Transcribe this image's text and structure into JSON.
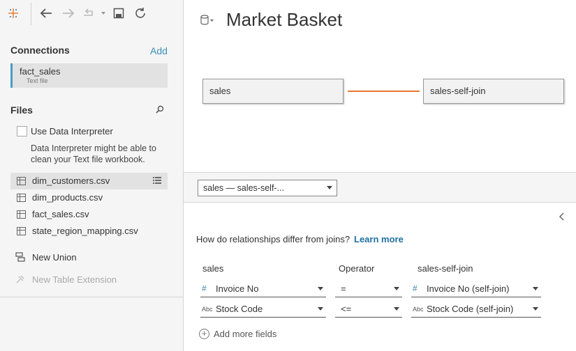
{
  "toolbar": {
    "icons": [
      "tableau-logo-icon",
      "back-icon",
      "forward-icon",
      "redo-icon",
      "save-icon",
      "refresh-icon"
    ]
  },
  "connections": {
    "title": "Connections",
    "add_label": "Add",
    "items": [
      {
        "name": "fact_sales",
        "type": "Text file"
      }
    ]
  },
  "files": {
    "title": "Files",
    "use_interpreter_label": "Use Data Interpreter",
    "interpreter_desc": "Data Interpreter might be able to clean your Text file workbook.",
    "items": [
      {
        "name": "dim_customers.csv",
        "selected": true
      },
      {
        "name": "dim_products.csv"
      },
      {
        "name": "fact_sales.csv"
      },
      {
        "name": "state_region_mapping.csv"
      }
    ],
    "new_union": "New Union",
    "new_table_extension": "New Table Extension"
  },
  "canvas": {
    "title": "Market Basket",
    "tables": [
      "sales",
      "sales-self-join"
    ],
    "relationship_color": "#e8762b"
  },
  "relationship": {
    "selected": "sales  —  sales-self-...",
    "help_question": "How do relationships differ from joins?",
    "learn_more": "Learn more",
    "headers": {
      "left": "sales",
      "operator": "Operator",
      "right": "sales-self-join"
    },
    "rows": [
      {
        "left_type": "#",
        "left": "Invoice No",
        "operator": "=",
        "right_type": "#",
        "right": "Invoice No (self-join)"
      },
      {
        "left_type": "Abc",
        "left": "Stock Code",
        "operator": "<=",
        "right_type": "Abc",
        "right": "Stock Code (self-join)"
      }
    ],
    "add_more": "Add more fields"
  }
}
